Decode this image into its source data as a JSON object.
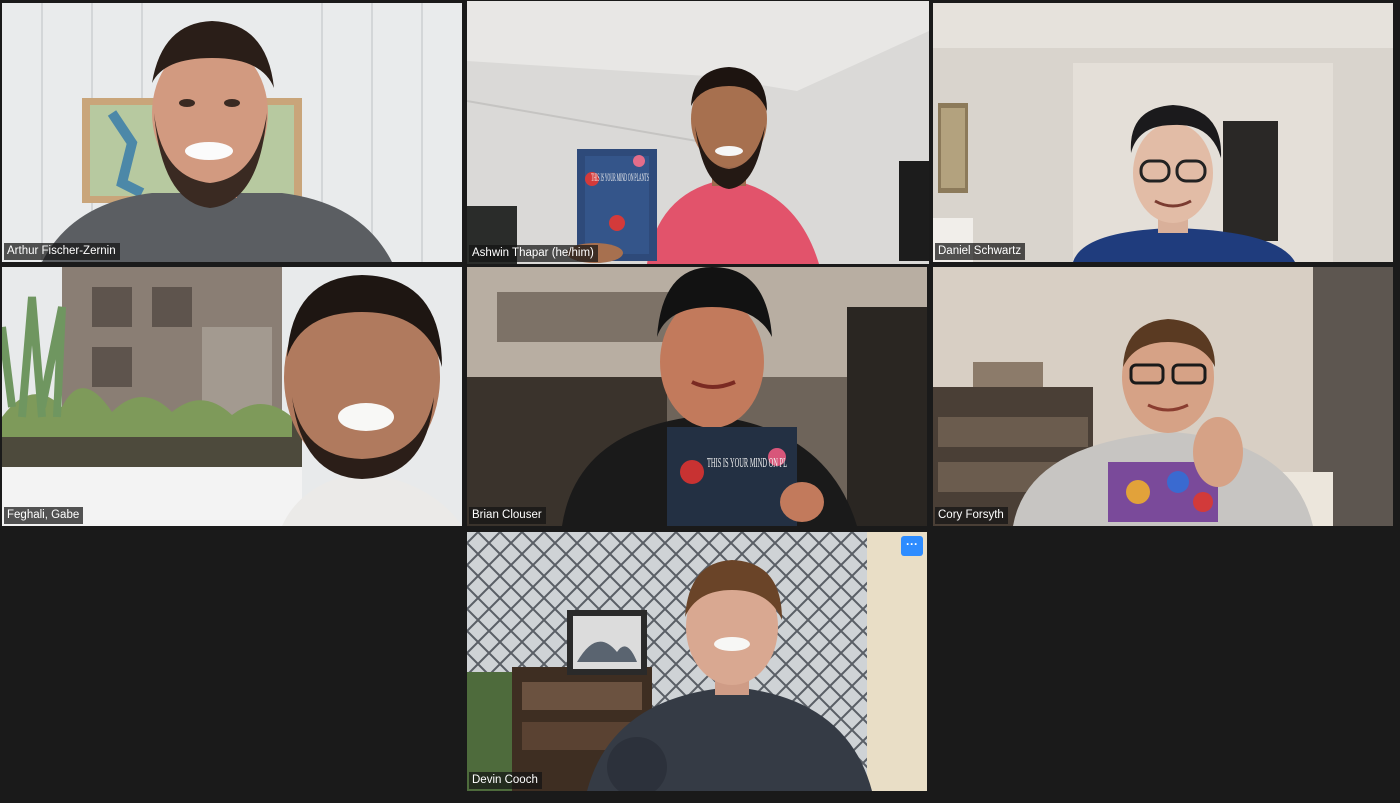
{
  "meeting": {
    "layout": "gallery-view",
    "active_speaker": "Ashwin Thapar (he/him)"
  },
  "colors": {
    "background": "#1a1a1a",
    "active_speaker_border": "#c6e15a",
    "more_button": "#2d8cff",
    "name_tag_bg": "#141414",
    "name_tag_text": "#ffffff"
  },
  "participants": [
    {
      "name": "Arthur Fischer-Zernin"
    },
    {
      "name": "Ashwin Thapar (he/him)",
      "book_title": "THIS IS YOUR MIND ON PLANTS"
    },
    {
      "name": "Daniel Schwartz"
    },
    {
      "name": "Feghali, Gabe"
    },
    {
      "name": "Brian Clouser",
      "book_title": "THIS IS YOUR MIND ON PL"
    },
    {
      "name": "Cory Forsyth"
    },
    {
      "name": "Devin Cooch",
      "more_button_icon": "ellipsis-icon",
      "more_button_label": "···"
    }
  ]
}
